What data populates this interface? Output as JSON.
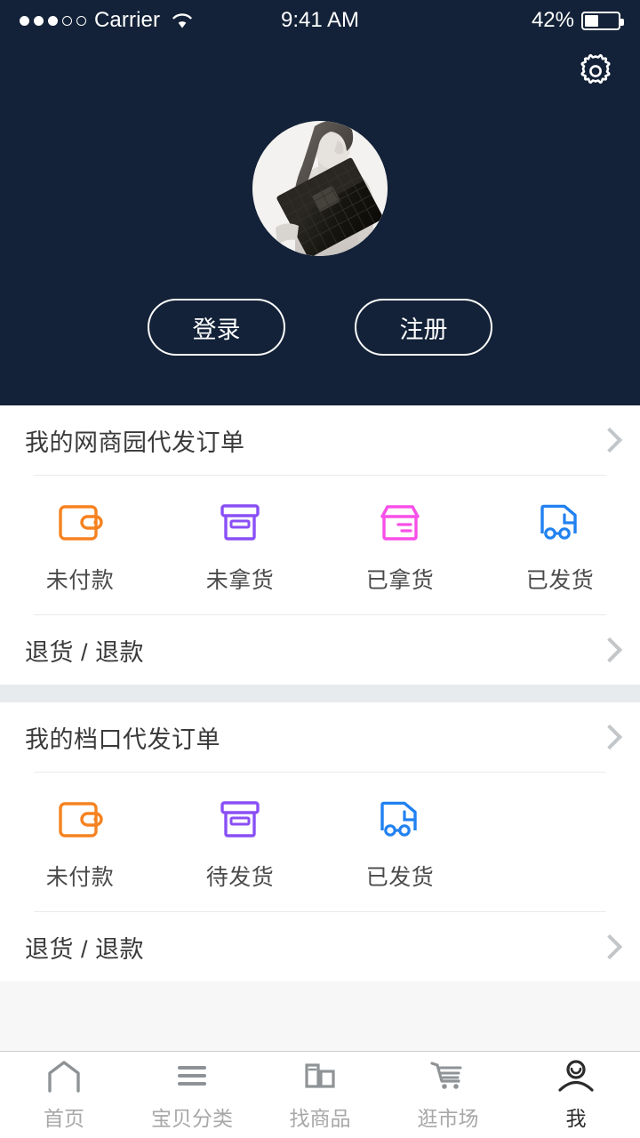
{
  "status_bar": {
    "carrier": "Carrier",
    "signal_dots_filled": 3,
    "signal_dots_total": 5,
    "wifi_icon": "wifi-icon",
    "time": "9:41 AM",
    "battery_percent": "42%",
    "battery_level": 42
  },
  "header": {
    "background_color": "#132238",
    "settings_icon": "gear-icon",
    "avatar_alt": "user-avatar-photo",
    "login_label": "登录",
    "register_label": "注册"
  },
  "sections": [
    {
      "title": "我的网商园代发订单",
      "chevron_icon": "chevron-right-icon",
      "statuses": [
        {
          "label": "未付款",
          "icon": "wallet-icon",
          "color": "#f58220"
        },
        {
          "label": "未拿货",
          "icon": "archive-box-icon",
          "color": "#8a4ff5"
        },
        {
          "label": "已拿货",
          "icon": "package-box-icon",
          "color": "#f84fe8"
        },
        {
          "label": "已发货",
          "icon": "delivery-truck-icon",
          "color": "#2181f0"
        }
      ],
      "footer_label": "退货 / 退款"
    },
    {
      "title": "我的档口代发订单",
      "chevron_icon": "chevron-right-icon",
      "statuses": [
        {
          "label": "未付款",
          "icon": "wallet-icon",
          "color": "#f58220"
        },
        {
          "label": "待发货",
          "icon": "archive-box-icon",
          "color": "#8a4ff5"
        },
        {
          "label": "已发货",
          "icon": "delivery-truck-icon",
          "color": "#2181f0"
        }
      ],
      "footer_label": "退货 / 退款"
    }
  ],
  "tabbar": {
    "items": [
      {
        "label": "首页",
        "icon": "home-icon",
        "active": false
      },
      {
        "label": "宝贝分类",
        "icon": "menu-lines-icon",
        "active": false
      },
      {
        "label": "找商品",
        "icon": "grid-layout-icon",
        "active": false
      },
      {
        "label": "逛市场",
        "icon": "shopping-cart-icon",
        "active": false
      },
      {
        "label": "我",
        "icon": "person-icon",
        "active": true
      }
    ]
  }
}
